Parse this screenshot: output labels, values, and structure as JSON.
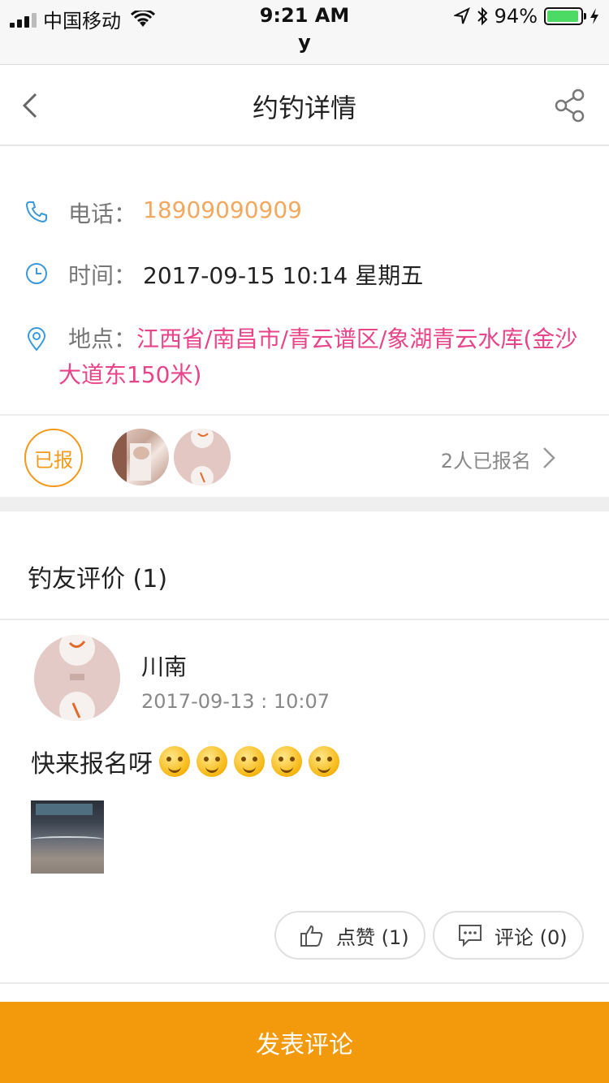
{
  "status_bar": {
    "carrier": "中国移动",
    "time": "9:21 AM",
    "subtitle": "y",
    "battery_percent": "94%",
    "battery_level": 0.94
  },
  "nav": {
    "title": "约钓详情",
    "back_icon": "chevron-left-icon",
    "share_icon": "share-icon"
  },
  "info": {
    "phone_label": "电话：",
    "phone_value": "18909090909",
    "time_label": "时间：",
    "time_value": "2017-09-15 10:14 星期五",
    "location_label": "地点：",
    "location_value": "江西省/南昌市/青云谱区/象湖青云水库(金沙大道东150米)"
  },
  "signup": {
    "badge": "已报",
    "count_text": "2人已报名"
  },
  "reviews": {
    "title": "钓友评价 (1)",
    "items": [
      {
        "name": "川南",
        "time": "2017-09-13 : 10:07",
        "text": "快来报名呀",
        "like_label": "点赞 (1)",
        "comment_label": "评论 (0)"
      }
    ]
  },
  "footer": {
    "cta": "发表评论"
  },
  "colors": {
    "accent": "#f29a0c",
    "phone": "#f2a85e",
    "location": "#e8448a",
    "icon_blue": "#3a9ad9"
  }
}
